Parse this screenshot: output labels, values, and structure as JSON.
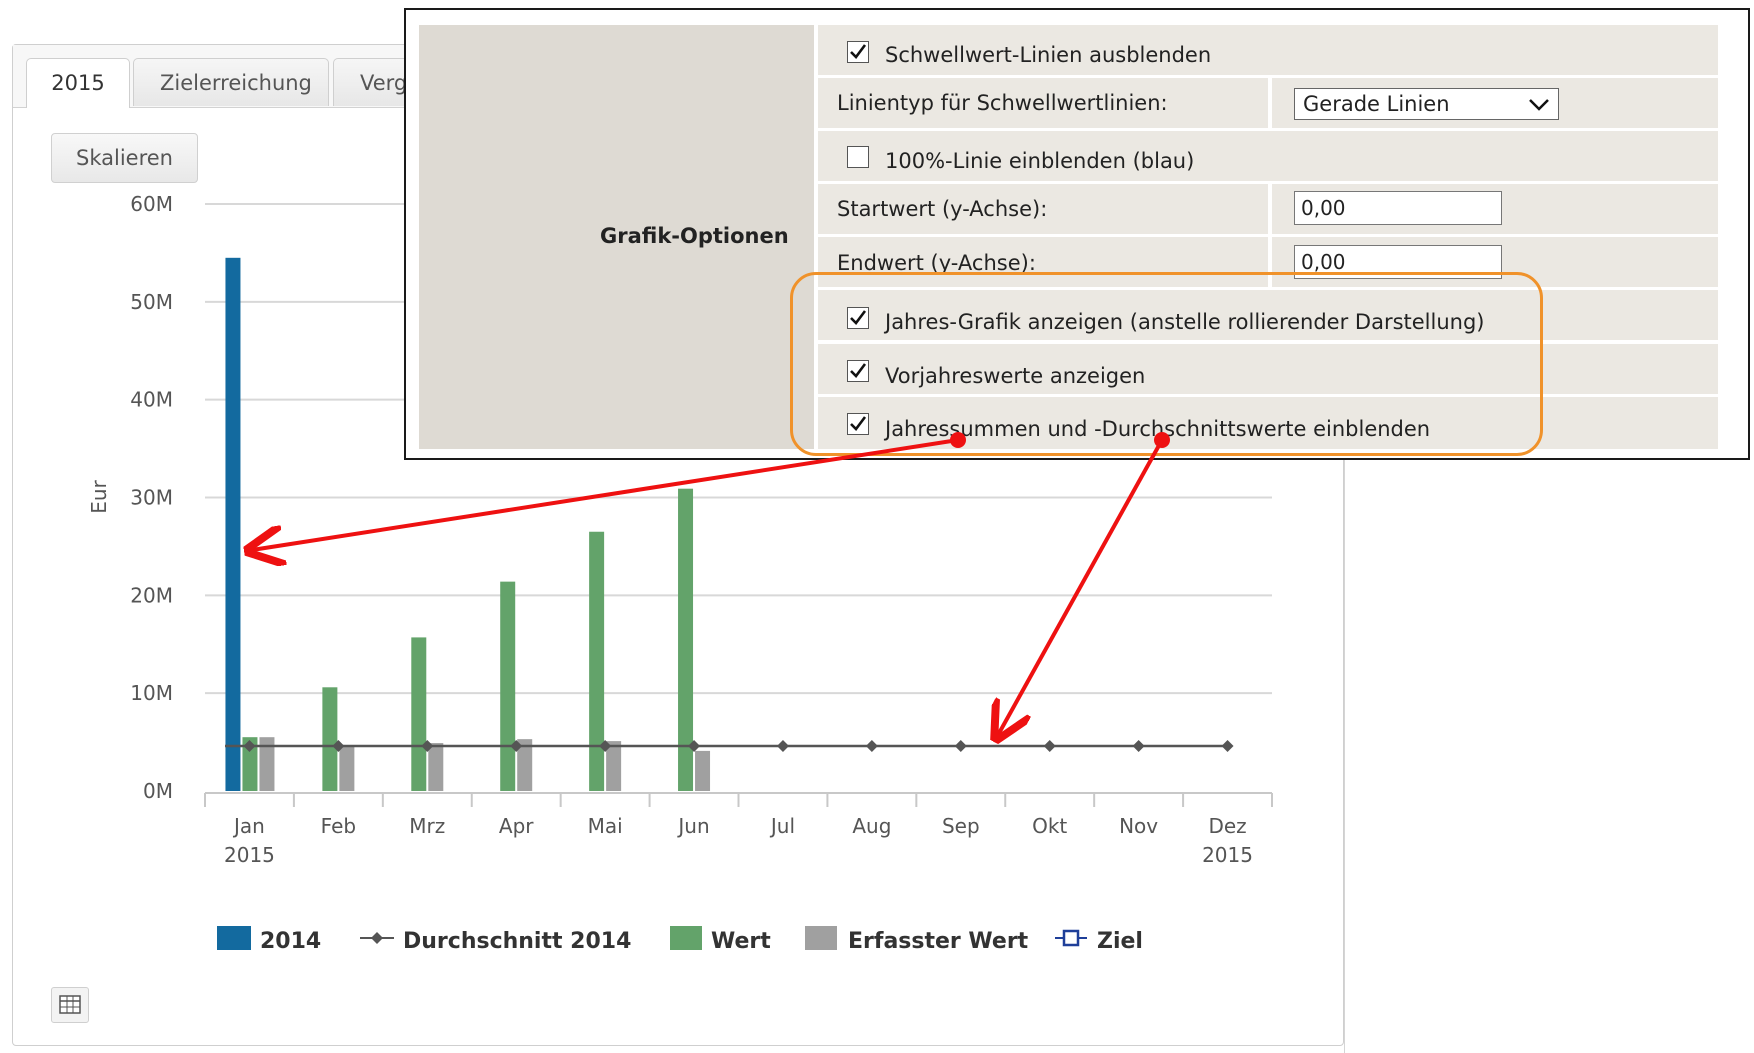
{
  "tabs": {
    "year": "2015",
    "target": "Zielerreichung",
    "compare": "Vergleich"
  },
  "toolbar": {
    "scale_label": "Skalieren"
  },
  "chart_data": {
    "type": "bar",
    "categories": [
      "Jan",
      "Feb",
      "Mrz",
      "Apr",
      "Mai",
      "Jun",
      "Jul",
      "Aug",
      "Sep",
      "Okt",
      "Nov",
      "Dez"
    ],
    "category_sublabels": [
      "2015",
      "",
      "",
      "",
      "",
      "",
      "",
      "",
      "",
      "",
      "",
      "2015"
    ],
    "ylabel": "Eur",
    "y_ticks": [
      "0M",
      "10M",
      "20M",
      "30M",
      "40M",
      "50M",
      "60M"
    ],
    "ylim": [
      0,
      60
    ],
    "unit": "M",
    "series": [
      {
        "name": "2014",
        "type": "bar",
        "color": "#136a9f",
        "values": [
          54.5,
          null,
          null,
          null,
          null,
          null,
          null,
          null,
          null,
          null,
          null,
          null
        ]
      },
      {
        "name": "Durchschnitt 2014",
        "type": "line",
        "color": "#555555",
        "values": [
          4.6,
          4.6,
          4.6,
          4.6,
          4.6,
          4.6,
          4.6,
          4.6,
          4.6,
          4.6,
          4.6,
          4.6
        ]
      },
      {
        "name": "Wert",
        "type": "bar",
        "color": "#63a36a",
        "values": [
          5.5,
          10.6,
          15.7,
          21.4,
          26.5,
          30.9,
          null,
          null,
          null,
          null,
          null,
          null
        ]
      },
      {
        "name": "Erfasster Wert",
        "type": "bar",
        "color": "#a0a0a0",
        "values": [
          5.5,
          4.7,
          4.9,
          5.3,
          5.1,
          4.1,
          null,
          null,
          null,
          null,
          null,
          null
        ]
      },
      {
        "name": "Ziel",
        "type": "line",
        "color": "#1f3f99",
        "values": []
      }
    ],
    "grid": true,
    "legend_position": "bottom"
  },
  "options": {
    "section_title": "Grafik-Optionen",
    "hide_threshold": {
      "label": "Schwellwert-Linien ausblenden",
      "checked": true
    },
    "line_type": {
      "label": "Linientyp für Schwellwertlinien:",
      "value": "Gerade Linien"
    },
    "show_100_line": {
      "label": "100%-Linie einblenden (blau)",
      "checked": false
    },
    "start_value": {
      "label": "Startwert (y-Achse):",
      "value": "0,00"
    },
    "end_value": {
      "label": "Endwert (y-Achse):",
      "value": "0,00"
    },
    "yearly_chart": {
      "label": "Jahres-Grafik anzeigen (anstelle rollierender Darstellung)",
      "checked": true
    },
    "prev_year": {
      "label": "Vorjahreswerte anzeigen",
      "checked": true
    },
    "year_sums": {
      "label": "Jahressummen und -Durchschnittswerte einblenden",
      "checked": true
    }
  },
  "colors": {
    "annotation_arrow": "#ee1111",
    "highlight": "#f0922a"
  }
}
